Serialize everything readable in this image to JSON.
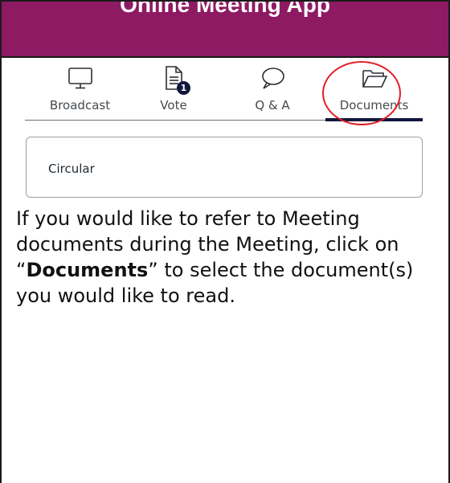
{
  "header": {
    "title": "Online Meeting App"
  },
  "tabs": [
    {
      "label": "Broadcast",
      "icon": "monitor-icon"
    },
    {
      "label": "Vote",
      "icon": "document-icon",
      "badge": "1"
    },
    {
      "label": "Q & A",
      "icon": "speech-bubble-icon"
    },
    {
      "label": "Documents",
      "icon": "folder-icon",
      "active": true
    }
  ],
  "documents": [
    {
      "title": "Circular"
    }
  ],
  "instruction": {
    "before": "If you would like to refer to Meeting documents during the Meeting, click on “",
    "emphasis": "Documents",
    "after": "” to select the document(s) you would like to read."
  },
  "colors": {
    "header": "#8e1a63",
    "accent": "#11163d",
    "highlight": "#e21f26"
  }
}
